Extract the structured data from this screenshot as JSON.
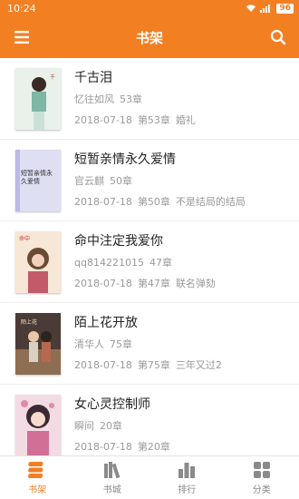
{
  "status_bar": {
    "time": "10:24",
    "battery": "96"
  },
  "header": {
    "title": "书架"
  },
  "books": [
    {
      "title": "千古泪",
      "author": "忆往如风",
      "chapters": "53章",
      "date": "2018-07-18",
      "last_chapter": "第53章",
      "chapter_title": "婚礼",
      "cover_color": "#e6efe6"
    },
    {
      "title": "短暂亲情永久爱情",
      "author": "官云麒",
      "chapters": "50章",
      "date": "2018-07-18",
      "last_chapter": "第50章",
      "chapter_title": "不是结局的结局",
      "cover_color": "#dcdcf2",
      "cover_text": "短暂亲情永久爱情"
    },
    {
      "title": "命中注定我爱你",
      "author": "qq814221015",
      "chapters": "47章",
      "date": "2018-07-18",
      "last_chapter": "第47章",
      "chapter_title": "联名弹劾",
      "cover_color": "#f4e3cf"
    },
    {
      "title": "陌上花开放",
      "author": "清华人",
      "chapters": "75章",
      "date": "2018-07-18",
      "last_chapter": "第75章",
      "chapter_title": "三年又过2",
      "cover_color": "#4a3a35"
    },
    {
      "title": "女心灵控制师",
      "author": "瞬间",
      "chapters": "20章",
      "date": "2018-07-18",
      "last_chapter": "第20章",
      "chapter_title": "",
      "cover_color": "#f1d9e2"
    }
  ],
  "tabs": [
    {
      "label": "书架",
      "icon": "bookshelf-icon"
    },
    {
      "label": "书城",
      "icon": "bookstore-icon"
    },
    {
      "label": "排行",
      "icon": "ranking-icon"
    },
    {
      "label": "分类",
      "icon": "category-icon"
    }
  ],
  "colors": {
    "accent": "#f37f23",
    "inactive": "#8a8a8a"
  }
}
